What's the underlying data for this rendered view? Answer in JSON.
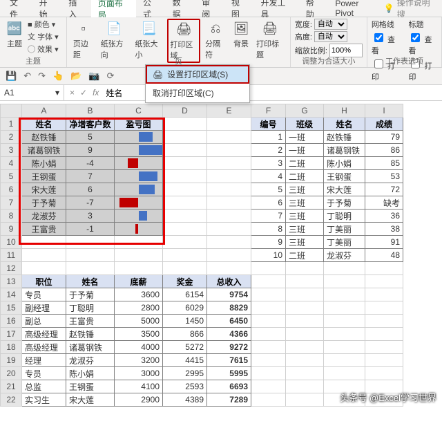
{
  "tabs": [
    "文件",
    "开始",
    "插入",
    "页面布局",
    "公式",
    "数据",
    "审阅",
    "视图",
    "开发工具",
    "帮助",
    "Power Pivot"
  ],
  "active_tab": "页面布局",
  "search_hint": "操作说明搜",
  "ribbon": {
    "theme_group": "主题",
    "theme_items": [
      "颜色",
      "字体",
      "效果"
    ],
    "theme_btn": "主题",
    "page_setup_btns": [
      "页边距",
      "纸张方向",
      "纸张大小",
      "打印区域",
      "分隔符",
      "背景",
      "打印标题"
    ],
    "page_setup_label": "页",
    "scale_labels": {
      "width": "宽度:",
      "height": "高度:",
      "scale": "缩放比例:"
    },
    "scale_auto": "自动",
    "scale_value": "100%",
    "scale_group_label": "调整为合适大小",
    "sheet_options": [
      "网格线",
      "标题",
      "查看",
      "查看",
      "打印",
      "打印"
    ],
    "sheet_group_label": "工作表选项"
  },
  "dropdown": {
    "set": "设置打印区域(S)",
    "clear": "取消打印区域(C)"
  },
  "namebox": "A1",
  "formula": "姓名",
  "columns": [
    "A",
    "B",
    "C",
    "D",
    "E",
    "F",
    "G",
    "H",
    "I"
  ],
  "table1": {
    "headers": [
      "姓名",
      "净增客户数",
      "盈亏图"
    ],
    "rows": [
      {
        "name": "赵铁锤",
        "val": 5,
        "bar": 0.56,
        "color": "blue"
      },
      {
        "name": "诸葛钢铁",
        "val": 9,
        "bar": 1.0,
        "color": "blue"
      },
      {
        "name": "陈小娟",
        "val": -4,
        "bar": -0.44,
        "color": "red"
      },
      {
        "name": "王钢蛋",
        "val": 7,
        "bar": 0.78,
        "color": "blue"
      },
      {
        "name": "宋大莲",
        "val": 6,
        "bar": 0.67,
        "color": "blue"
      },
      {
        "name": "于予菊",
        "val": -7,
        "bar": -0.78,
        "color": "red"
      },
      {
        "name": "龙淑芬",
        "val": 3,
        "bar": 0.33,
        "color": "blue"
      },
      {
        "name": "王富贵",
        "val": -1,
        "bar": -0.11,
        "color": "red"
      }
    ]
  },
  "table2": {
    "headers": [
      "编号",
      "班级",
      "姓名",
      "成绩"
    ],
    "rows": [
      {
        "id": 1,
        "class": "一班",
        "name": "赵铁锤",
        "score": "79"
      },
      {
        "id": 2,
        "class": "一班",
        "name": "诸葛钢铁",
        "score": "86"
      },
      {
        "id": 3,
        "class": "二班",
        "name": "陈小娟",
        "score": "85"
      },
      {
        "id": 4,
        "class": "二班",
        "name": "王钢蛋",
        "score": "53"
      },
      {
        "id": 5,
        "class": "三班",
        "name": "宋大莲",
        "score": "72"
      },
      {
        "id": 6,
        "class": "三班",
        "name": "于予菊",
        "score": "缺考"
      },
      {
        "id": 7,
        "class": "三班",
        "name": "丁聪明",
        "score": "36"
      },
      {
        "id": 8,
        "class": "三班",
        "name": "丁美丽",
        "score": "38"
      },
      {
        "id": 9,
        "class": "三班",
        "name": "丁美丽",
        "score": "91"
      },
      {
        "id": 10,
        "class": "二班",
        "name": "龙淑芬",
        "score": "48"
      }
    ]
  },
  "table3": {
    "headers": [
      "职位",
      "姓名",
      "底薪",
      "奖金",
      "总收入"
    ],
    "rows": [
      {
        "pos": "专员",
        "name": "于予菊",
        "base": 3600,
        "bonus": 6154,
        "total": 9754
      },
      {
        "pos": "副经理",
        "name": "丁聪明",
        "base": 2800,
        "bonus": 6029,
        "total": 8829
      },
      {
        "pos": "副总",
        "name": "王富贵",
        "base": 5000,
        "bonus": 1450,
        "total": 6450
      },
      {
        "pos": "高级经理",
        "name": "赵铁锤",
        "base": 3500,
        "bonus": 866,
        "total": 4366
      },
      {
        "pos": "高级经理",
        "name": "诸葛钢铁",
        "base": 4000,
        "bonus": 5272,
        "total": 9272
      },
      {
        "pos": "经理",
        "name": "龙淑芬",
        "base": 3200,
        "bonus": 4415,
        "total": 7615
      },
      {
        "pos": "专员",
        "name": "陈小娟",
        "base": 3000,
        "bonus": 2995,
        "total": 5995
      },
      {
        "pos": "总监",
        "name": "王钢蛋",
        "base": 4100,
        "bonus": 2593,
        "total": 6693
      },
      {
        "pos": "实习生",
        "name": "宋大莲",
        "base": 2900,
        "bonus": 4389,
        "total": 7289
      }
    ]
  },
  "watermark": "头条号 @Excel学习世界",
  "chart_data": {
    "type": "bar",
    "title": "盈亏图",
    "categories": [
      "赵铁锤",
      "诸葛钢铁",
      "陈小娟",
      "王钢蛋",
      "宋大莲",
      "于予菊",
      "龙淑芬",
      "王富贵"
    ],
    "values": [
      5,
      9,
      -4,
      7,
      6,
      -7,
      3,
      -1
    ],
    "xlabel": "",
    "ylabel": "净增客户数"
  }
}
